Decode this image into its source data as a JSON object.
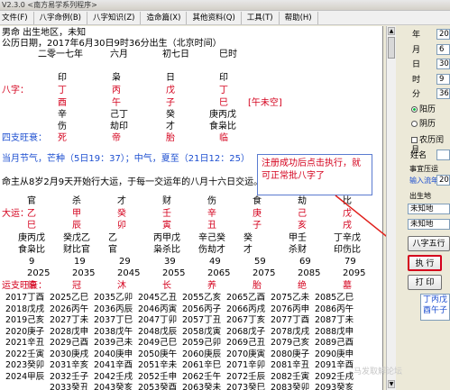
{
  "window": {
    "title": "V2.3.0  <南方易学系列程序>"
  },
  "menu": [
    "文件(F)",
    "八字命例(B)",
    "八字知识(Z)",
    "造命篇(X)",
    "其他资料(Q)",
    "工具(T)",
    "帮助(H)"
  ],
  "header": {
    "line1": "男命          出生地区，未知",
    "line2": "公历日期，2017年6月30日9时36分出生（北京时间）",
    "lunar": [
      "二零一七年",
      "六月",
      "初七日",
      "巳时"
    ]
  },
  "bazi": {
    "top": [
      "印",
      "枭",
      "日",
      "印"
    ],
    "label": "八字：",
    "stems": [
      "丁",
      "丙",
      "戊",
      "丁"
    ],
    "branches": [
      "酉",
      "午",
      "子",
      "巳"
    ],
    "kongwang": "[午未空]",
    "hidden": [
      "辛",
      "己丁",
      "癸",
      "庚丙戊"
    ],
    "gods": [
      "伤",
      "劫印",
      "才",
      "食枭比"
    ],
    "sizhu_label": "四支旺衰：",
    "status": [
      "死",
      "帝",
      "胎",
      "临"
    ]
  },
  "solar_term": "当月节气，芒种（5日19：37）；中气，夏至（21日12：25）",
  "start_luck": "命主从8岁2月9天开始行大运，于每一交运年的八月十六日交运。",
  "dayun": {
    "top": [
      "官",
      "杀",
      "才",
      "财",
      "伤",
      "食",
      "劫",
      "比"
    ],
    "label": "大运：",
    "stems": [
      "乙",
      "甲",
      "癸",
      "壬",
      "辛",
      "庚",
      "己",
      "戊"
    ],
    "branches": [
      "巳",
      "辰",
      "卯",
      "寅",
      "丑",
      "子",
      "亥",
      "戌"
    ],
    "hidden": [
      "庚丙戊",
      "癸戊乙",
      "乙",
      "丙甲戊",
      "辛己癸",
      "癸",
      "甲壬",
      "丁辛戊"
    ],
    "gods": [
      "食枭比",
      "财比官",
      "官",
      "枭杀比",
      "伤劫才",
      "才",
      "杀财",
      "印伤比"
    ],
    "ages": [
      "9",
      "19",
      "29",
      "39",
      "49",
      "59",
      "69",
      "79"
    ],
    "years": [
      "2025",
      "2035",
      "2045",
      "2055",
      "2065",
      "2075",
      "2085",
      "2095"
    ],
    "state_label": "运支旺衰：",
    "states": [
      "临",
      "冠",
      "沐",
      "长",
      "养",
      "胎",
      "绝",
      "墓"
    ]
  },
  "liunian": [
    [
      "2017丁酉",
      "2025乙巳",
      "2035乙卯",
      "2045乙丑",
      "2055乙亥",
      "2065乙酉",
      "2075乙未",
      "2085乙巳"
    ],
    [
      "2018戊戌",
      "2026丙午",
      "2036丙辰",
      "2046丙寅",
      "2056丙子",
      "2066丙戌",
      "2076丙申",
      "2086丙午"
    ],
    [
      "2019己亥",
      "2027丁未",
      "2037丁巳",
      "2047丁卯",
      "2057丁丑",
      "2067丁亥",
      "2077丁酉",
      "2087丁未"
    ],
    [
      "2020庚子",
      "2028戊申",
      "2038戊午",
      "2048戊辰",
      "2058戊寅",
      "2068戊子",
      "2078戊戌",
      "2088戊申"
    ],
    [
      "2021辛丑",
      "2029己酉",
      "2039己未",
      "2049己巳",
      "2059己卯",
      "2069己丑",
      "2079己亥",
      "2089己酉"
    ],
    [
      "2022壬寅",
      "2030庚戌",
      "2040庚申",
      "2050庚午",
      "2060庚辰",
      "2070庚寅",
      "2080庚子",
      "2090庚申"
    ],
    [
      "2023癸卯",
      "2031辛亥",
      "2041辛酉",
      "2051辛未",
      "2061辛巳",
      "2071辛卯",
      "2081辛丑",
      "2091辛酉"
    ],
    [
      "2024甲辰",
      "2032壬子",
      "2042壬戌",
      "2052壬申",
      "2062壬午",
      "2072壬辰",
      "2082壬寅",
      "2092壬戌"
    ],
    [
      "",
      "2033癸丑",
      "2043癸亥",
      "2053癸酉",
      "2063癸未",
      "2073癸巳",
      "2083癸卯",
      "2093癸亥"
    ]
  ],
  "callout": "注册成功后点击执行，就可正常批八字了",
  "side": {
    "year_label": "年",
    "year_value": "201",
    "month_label": "月",
    "month_value": "6",
    "day_label": "日",
    "day_value": "30",
    "hour_label": "时",
    "hour_value": "9",
    "minute_label": "分",
    "minute_value": "36",
    "solar_label": "阳历",
    "lunar_label": "阴历",
    "leap_label": "农历闰月",
    "name_label": "姓名",
    "time_label": "事宜压运",
    "input_label": "输入流年",
    "input_value": "20",
    "birthplace_label": "出生地",
    "place1": "未知地",
    "place2": "未知地",
    "wuxing_button": "八字五行",
    "exec_button": "执 行",
    "print_button": "打 印",
    "output": [
      "丁丙戊",
      "酉午子"
    ]
  },
  "watermark": "马发取解论坛"
}
